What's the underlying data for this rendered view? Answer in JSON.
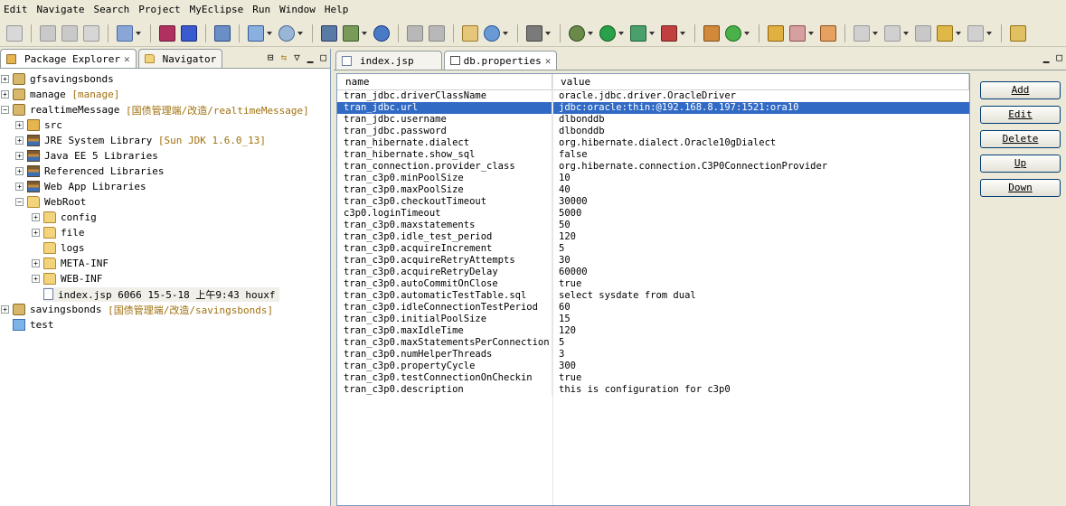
{
  "menu": [
    "Edit",
    "Navigate",
    "Search",
    "Project",
    "MyEclipse",
    "Run",
    "Window",
    "Help"
  ],
  "left_panel": {
    "tabs": [
      {
        "label": "Package Explorer"
      },
      {
        "label": "Navigator"
      }
    ],
    "tree": [
      {
        "label": "gfsavingsbonds",
        "deco": ""
      },
      {
        "label": "manage",
        "deco": "[manage]"
      },
      {
        "label": "realtimeMessage",
        "deco": "[国债管理端/改造/realtimeMessage]"
      },
      {
        "label": "src"
      },
      {
        "label": "JRE System Library",
        "deco": "[Sun JDK 1.6.0_13]"
      },
      {
        "label": "Java EE 5 Libraries"
      },
      {
        "label": "Referenced Libraries"
      },
      {
        "label": "Web App Libraries"
      },
      {
        "label": "WebRoot"
      },
      {
        "label": "config"
      },
      {
        "label": "file"
      },
      {
        "label": "logs"
      },
      {
        "label": "META-INF"
      },
      {
        "label": "WEB-INF"
      },
      {
        "label": "index.jsp 6066  15-5-18 上午9:43  houxf"
      },
      {
        "label": "savingsbonds",
        "deco": "[国债管理端/改造/savingsbonds]"
      },
      {
        "label": "test"
      }
    ]
  },
  "editor": {
    "tabs": [
      {
        "label": "index.jsp"
      },
      {
        "label": "db.properties"
      }
    ],
    "columns": {
      "name": "name",
      "value": "value"
    },
    "rows": [
      {
        "name": "tran_jdbc.driverClassName",
        "value": "oracle.jdbc.driver.OracleDriver"
      },
      {
        "name": "tran_jdbc.url",
        "value": "jdbc:oracle:thin:@192.168.8.197:1521:ora10"
      },
      {
        "name": "tran_jdbc.username",
        "value": "dlbonddb"
      },
      {
        "name": "tran_jdbc.password",
        "value": "dlbonddb"
      },
      {
        "name": "tran_hibernate.dialect",
        "value": "org.hibernate.dialect.Oracle10gDialect"
      },
      {
        "name": "tran_hibernate.show_sql",
        "value": "false"
      },
      {
        "name": "tran_connection.provider_class",
        "value": "org.hibernate.connection.C3P0ConnectionProvider"
      },
      {
        "name": "tran_c3p0.minPoolSize",
        "value": "10"
      },
      {
        "name": "tran_c3p0.maxPoolSize",
        "value": "40"
      },
      {
        "name": "tran_c3p0.checkoutTimeout",
        "value": "30000"
      },
      {
        "name": "c3p0.loginTimeout",
        "value": "5000"
      },
      {
        "name": "tran_c3p0.maxstatements",
        "value": "50"
      },
      {
        "name": "tran_c3p0.idle_test_period",
        "value": "120"
      },
      {
        "name": "tran_c3p0.acquireIncrement",
        "value": "5"
      },
      {
        "name": "tran_c3p0.acquireRetryAttempts",
        "value": "30"
      },
      {
        "name": "tran_c3p0.acquireRetryDelay",
        "value": "60000"
      },
      {
        "name": "tran_c3p0.autoCommitOnClose",
        "value": "true"
      },
      {
        "name": "tran_c3p0.automaticTestTable.sql",
        "value": "select sysdate from dual"
      },
      {
        "name": "tran_c3p0.idleConnectionTestPeriod",
        "value": "60"
      },
      {
        "name": "tran_c3p0.initialPoolSize",
        "value": "15"
      },
      {
        "name": "tran_c3p0.maxIdleTime",
        "value": "120"
      },
      {
        "name": "tran_c3p0.maxStatementsPerConnection",
        "value": "5"
      },
      {
        "name": "tran_c3p0.numHelperThreads",
        "value": "3"
      },
      {
        "name": "tran_c3p0.propertyCycle",
        "value": "300"
      },
      {
        "name": "tran_c3p0.testConnectionOnCheckin",
        "value": "true"
      },
      {
        "name": "tran_c3p0.description",
        "value": "this is configuration for c3p0"
      }
    ],
    "selected_row": "tran_jdbc.url"
  },
  "buttons": {
    "add": "Add",
    "edit": "Edit",
    "delete": "Delete",
    "up": "Up",
    "down": "Down"
  },
  "colors": {
    "selection": "#316ac5",
    "decoration": "#a0700e"
  }
}
